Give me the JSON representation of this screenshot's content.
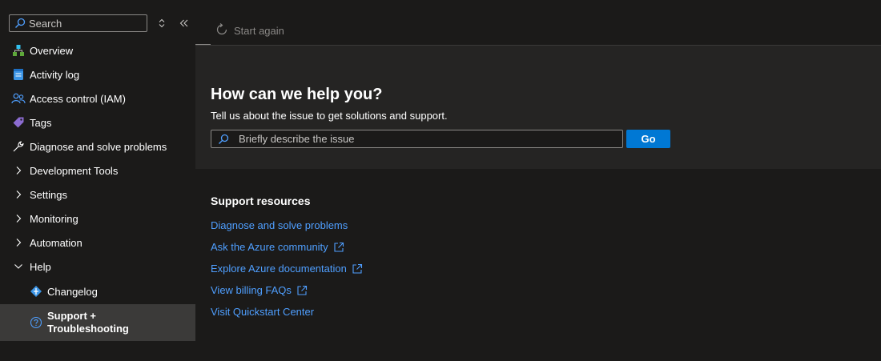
{
  "sidebar": {
    "search": {
      "placeholder": "Search"
    },
    "items": [
      {
        "label": "Overview",
        "icon": "overview-icon"
      },
      {
        "label": "Activity log",
        "icon": "activity-log-icon"
      },
      {
        "label": "Access control (IAM)",
        "icon": "people-icon"
      },
      {
        "label": "Tags",
        "icon": "tag-icon"
      },
      {
        "label": "Diagnose and solve problems",
        "icon": "wrench-icon"
      },
      {
        "label": "Development Tools",
        "icon": "chevron-right-icon"
      },
      {
        "label": "Settings",
        "icon": "chevron-right-icon"
      },
      {
        "label": "Monitoring",
        "icon": "chevron-right-icon"
      },
      {
        "label": "Automation",
        "icon": "chevron-right-icon"
      },
      {
        "label": "Help",
        "icon": "chevron-down-icon"
      },
      {
        "label": "Changelog",
        "icon": "changelog-icon"
      },
      {
        "label": "Support + Troubleshooting",
        "icon": "question-icon"
      }
    ]
  },
  "toolbar": {
    "start_again_label": "Start again"
  },
  "help": {
    "title": "How can we help you?",
    "subtitle": "Tell us about the issue to get solutions and support.",
    "issue_placeholder": "Briefly describe the issue",
    "go_label": "Go"
  },
  "resources": {
    "title": "Support resources",
    "links": [
      {
        "label": "Diagnose and solve problems",
        "external": false
      },
      {
        "label": "Ask the Azure community",
        "external": true
      },
      {
        "label": "Explore Azure documentation",
        "external": true
      },
      {
        "label": "View billing FAQs",
        "external": true
      },
      {
        "label": "Visit Quickstart Center",
        "external": false
      }
    ]
  },
  "colors": {
    "accent": "#0078d4",
    "link": "#4f9fff",
    "background": "#1b1a19",
    "panel": "#252423",
    "active": "#3b3a39"
  }
}
